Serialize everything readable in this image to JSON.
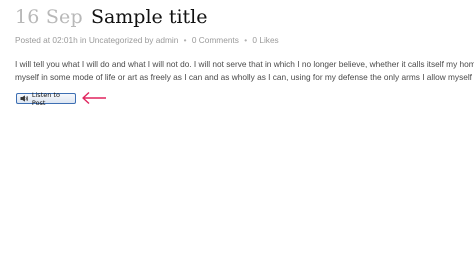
{
  "post": {
    "date": "16 Sep",
    "title": "Sample title"
  },
  "meta": {
    "posted_prefix": "Posted at 02:01h in",
    "category": "Uncategorized",
    "by_prefix": "by",
    "author": "admin",
    "separator": "•",
    "comments": "0 Comments",
    "likes": "0 Likes"
  },
  "content": {
    "line1": "I will tell you what I will do and what I will not do. I will not serve that in which I no longer believe, whether it calls itself my home, my",
    "line2": "myself in some mode of life or art as freely as I can and as wholly as I can, using for my defense the only arms I allow myself to use"
  },
  "player": {
    "button_label": "Listen to Post",
    "icon": "speaker-icon"
  },
  "annotation": {
    "arrow_color": "#e0245e",
    "icon": "arrow-left-icon"
  }
}
